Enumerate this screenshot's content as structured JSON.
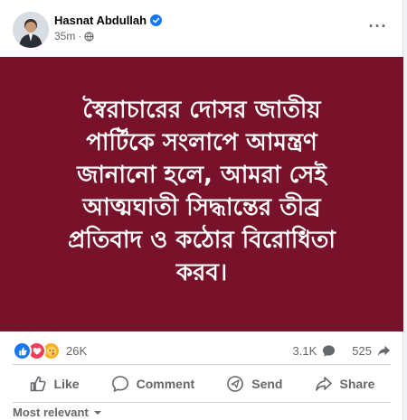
{
  "post": {
    "author": "Hasnat Abdullah",
    "time": "35m",
    "image_text": "স্বৈরাচারের দোসর জাতীয়\nপার্টিকে সংলাপে আমন্ত্রণ\nজানানো হলে, আমরা সেই\nআত্মঘাতী সিদ্ধান্তের তীব্র\nপ্রতিবাদ ও কঠোর বিরোধিতা\nকরব।",
    "image_bg": "#78122a"
  },
  "stats": {
    "reactions_count": "26K",
    "comments_count": "3.1K",
    "shares_count": "525"
  },
  "actions": {
    "like": "Like",
    "comment": "Comment",
    "send": "Send",
    "share": "Share"
  },
  "comments": {
    "sort_label": "Most relevant"
  },
  "icons": [
    "verified-badge-icon",
    "globe-icon",
    "more-options-icon",
    "like-reaction-icon",
    "love-reaction-icon",
    "care-reaction-icon",
    "comment-bubble-icon",
    "share-arrow-icon",
    "thumbs-up-icon",
    "chat-icon",
    "send-icon",
    "share-icon",
    "chevron-down-icon"
  ],
  "colors": {
    "accent": "#1877f2",
    "text_secondary": "#65676b"
  }
}
